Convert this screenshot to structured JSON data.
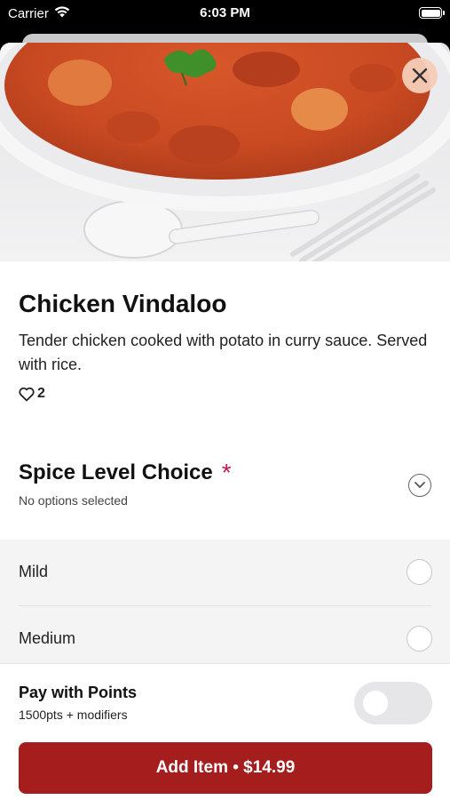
{
  "status_bar": {
    "carrier": "Carrier",
    "time": "6:03 PM"
  },
  "item": {
    "name": "Chicken Vindaloo",
    "description": "Tender chicken cooked with potato in curry sauce. Served with rice.",
    "likes": "2"
  },
  "modifier_group": {
    "title": "Spice Level Choice",
    "required_mark": "*",
    "subtitle": "No options selected",
    "options": [
      {
        "label": "Mild",
        "selected": false
      },
      {
        "label": "Medium",
        "selected": false
      }
    ]
  },
  "points": {
    "title": "Pay with Points",
    "subtitle": "1500pts + modifiers",
    "enabled": false
  },
  "add_button": {
    "label": "Add Item • $14.99"
  },
  "colors": {
    "accent": "#a61d1d",
    "required": "#c2185b",
    "close_button_bg": "#f5cdb9",
    "option_bg": "#f4f4f5"
  },
  "icons": [
    "wifi-icon",
    "battery-icon",
    "close-icon",
    "heart-icon",
    "chevron-down-icon"
  ]
}
